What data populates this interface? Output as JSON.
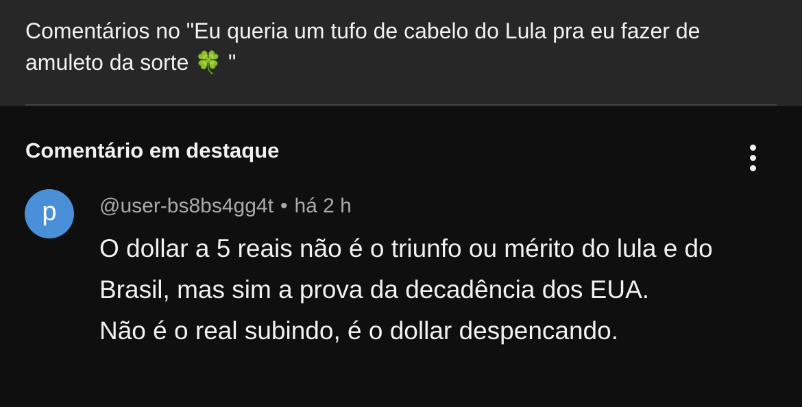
{
  "header": {
    "title": "Comentários no \"Eu queria um tufo de cabelo do Lula pra eu fazer de amuleto da sorte 🍀 \""
  },
  "section": {
    "title": "Comentário em destaque",
    "more_icon": "more-vertical-icon"
  },
  "comment": {
    "avatar_letter": "p",
    "avatar_color": "#4a90d9",
    "author": "@user-bs8bs4gg4t",
    "separator": "•",
    "time": "há 2 h",
    "paragraph_1": "O dollar a 5 reais não é o triunfo ou mérito do lula e do Brasil, mas sim a prova da decadência dos EUA.",
    "paragraph_2": "Não é o real subindo, é o dollar despencando."
  }
}
